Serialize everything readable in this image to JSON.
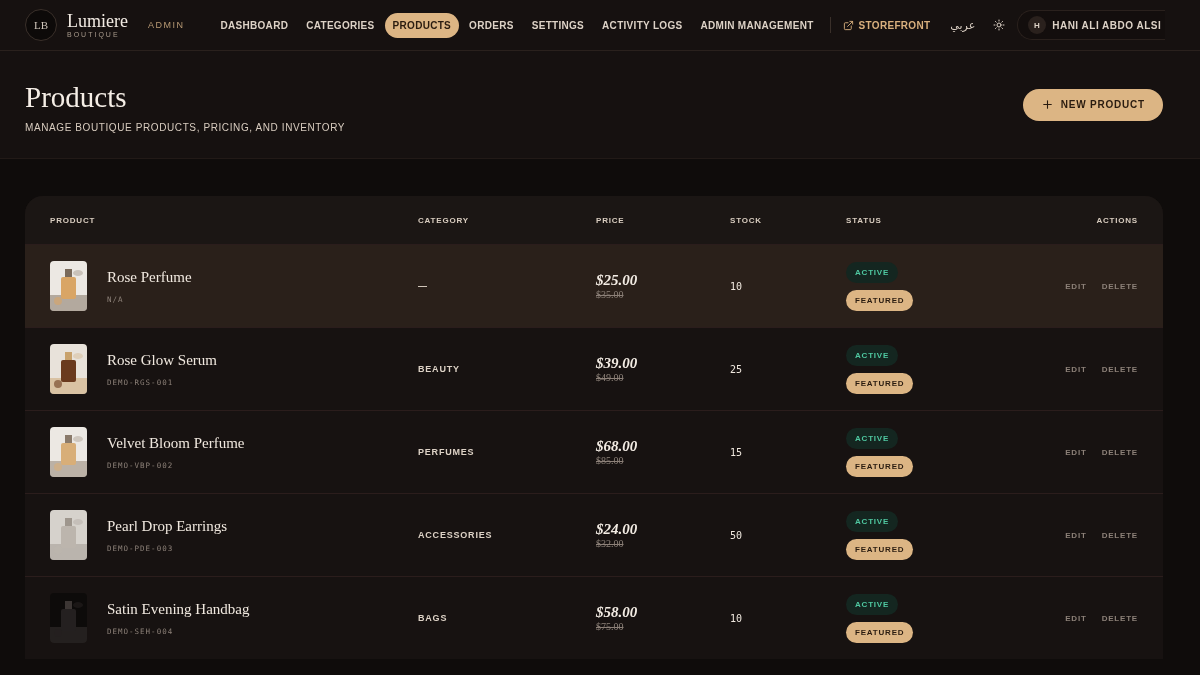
{
  "brand": {
    "monogram": "LB",
    "name": "Lumiere",
    "tagline": "BOUTIQUE",
    "role": "ADMIN"
  },
  "nav": [
    {
      "label": "DASHBOARD",
      "selected": false
    },
    {
      "label": "CATEGORIES",
      "selected": false
    },
    {
      "label": "PRODUCTS",
      "selected": true
    },
    {
      "label": "ORDERS",
      "selected": false
    },
    {
      "label": "SETTINGS",
      "selected": false
    },
    {
      "label": "ACTIVITY LOGS",
      "selected": false
    },
    {
      "label": "ADMIN MANAGEMENT",
      "selected": false
    }
  ],
  "storefront": "STOREFRONT",
  "language": "عربي",
  "user": {
    "initial": "H",
    "name": "HANI ALI ABDO ALSI"
  },
  "header": {
    "title": "Products",
    "subtitle": "MANAGE BOUTIQUE PRODUCTS, PRICING, AND INVENTORY",
    "new_button": "NEW PRODUCT"
  },
  "table": {
    "columns": [
      "PRODUCT",
      "CATEGORY",
      "PRICE",
      "STOCK",
      "STATUS",
      "ACTIONS"
    ],
    "rows": [
      {
        "name": "Rose Perfume",
        "sku": "N/A",
        "category": "—",
        "price": "$25.00",
        "old_price": "$35.00",
        "stock": "10",
        "status": "ACTIVE",
        "badge": "FEATURED",
        "highlighted": true,
        "edit": "EDIT",
        "delete": "DELETE"
      },
      {
        "name": "Rose Glow Serum",
        "sku": "DEMO-RGS-001",
        "category": "BEAUTY",
        "price": "$39.00",
        "old_price": "$49.00",
        "stock": "25",
        "status": "ACTIVE",
        "badge": "FEATURED",
        "highlighted": false,
        "edit": "EDIT",
        "delete": "DELETE"
      },
      {
        "name": "Velvet Bloom Perfume",
        "sku": "DEMO-VBP-002",
        "category": "PERFUMES",
        "price": "$68.00",
        "old_price": "$85.00",
        "stock": "15",
        "status": "ACTIVE",
        "badge": "FEATURED",
        "highlighted": false,
        "edit": "EDIT",
        "delete": "DELETE"
      },
      {
        "name": "Pearl Drop Earrings",
        "sku": "DEMO-PDE-003",
        "category": "ACCESSORIES",
        "price": "$24.00",
        "old_price": "$32.00",
        "stock": "50",
        "status": "ACTIVE",
        "badge": "FEATURED",
        "highlighted": false,
        "edit": "EDIT",
        "delete": "DELETE"
      },
      {
        "name": "Satin Evening Handbag",
        "sku": "DEMO-SEH-004",
        "category": "BAGS",
        "price": "$58.00",
        "old_price": "$75.00",
        "stock": "10",
        "status": "ACTIVE",
        "badge": "FEATURED",
        "highlighted": false,
        "edit": "EDIT",
        "delete": "DELETE"
      }
    ]
  }
}
